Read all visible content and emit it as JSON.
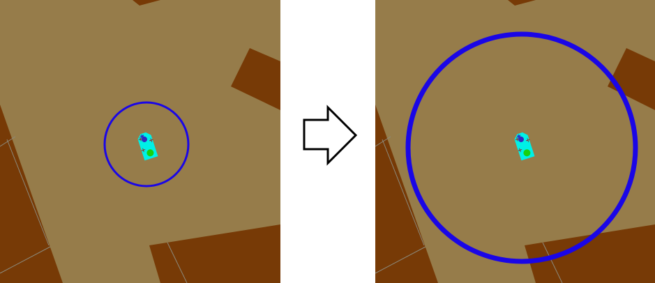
{
  "colors": {
    "floor": "#967C4A",
    "wall": "#773A06",
    "grid_line": "#8C8A7C",
    "robot_range_circle": "#1A06E6",
    "robot_body": "#00F0E6",
    "robot_marker_green": "#18D010",
    "robot_sensor_red": "#B00000",
    "robot_core": "#2F2AC2",
    "arrow_fill": "#ffffff",
    "arrow_stroke": "#000000",
    "background": "#ffffff"
  },
  "scene": {
    "left": {
      "range_circle": "small"
    },
    "right": {
      "range_circle": "large"
    }
  },
  "arrow": {
    "icon": "right-arrow-icon"
  }
}
